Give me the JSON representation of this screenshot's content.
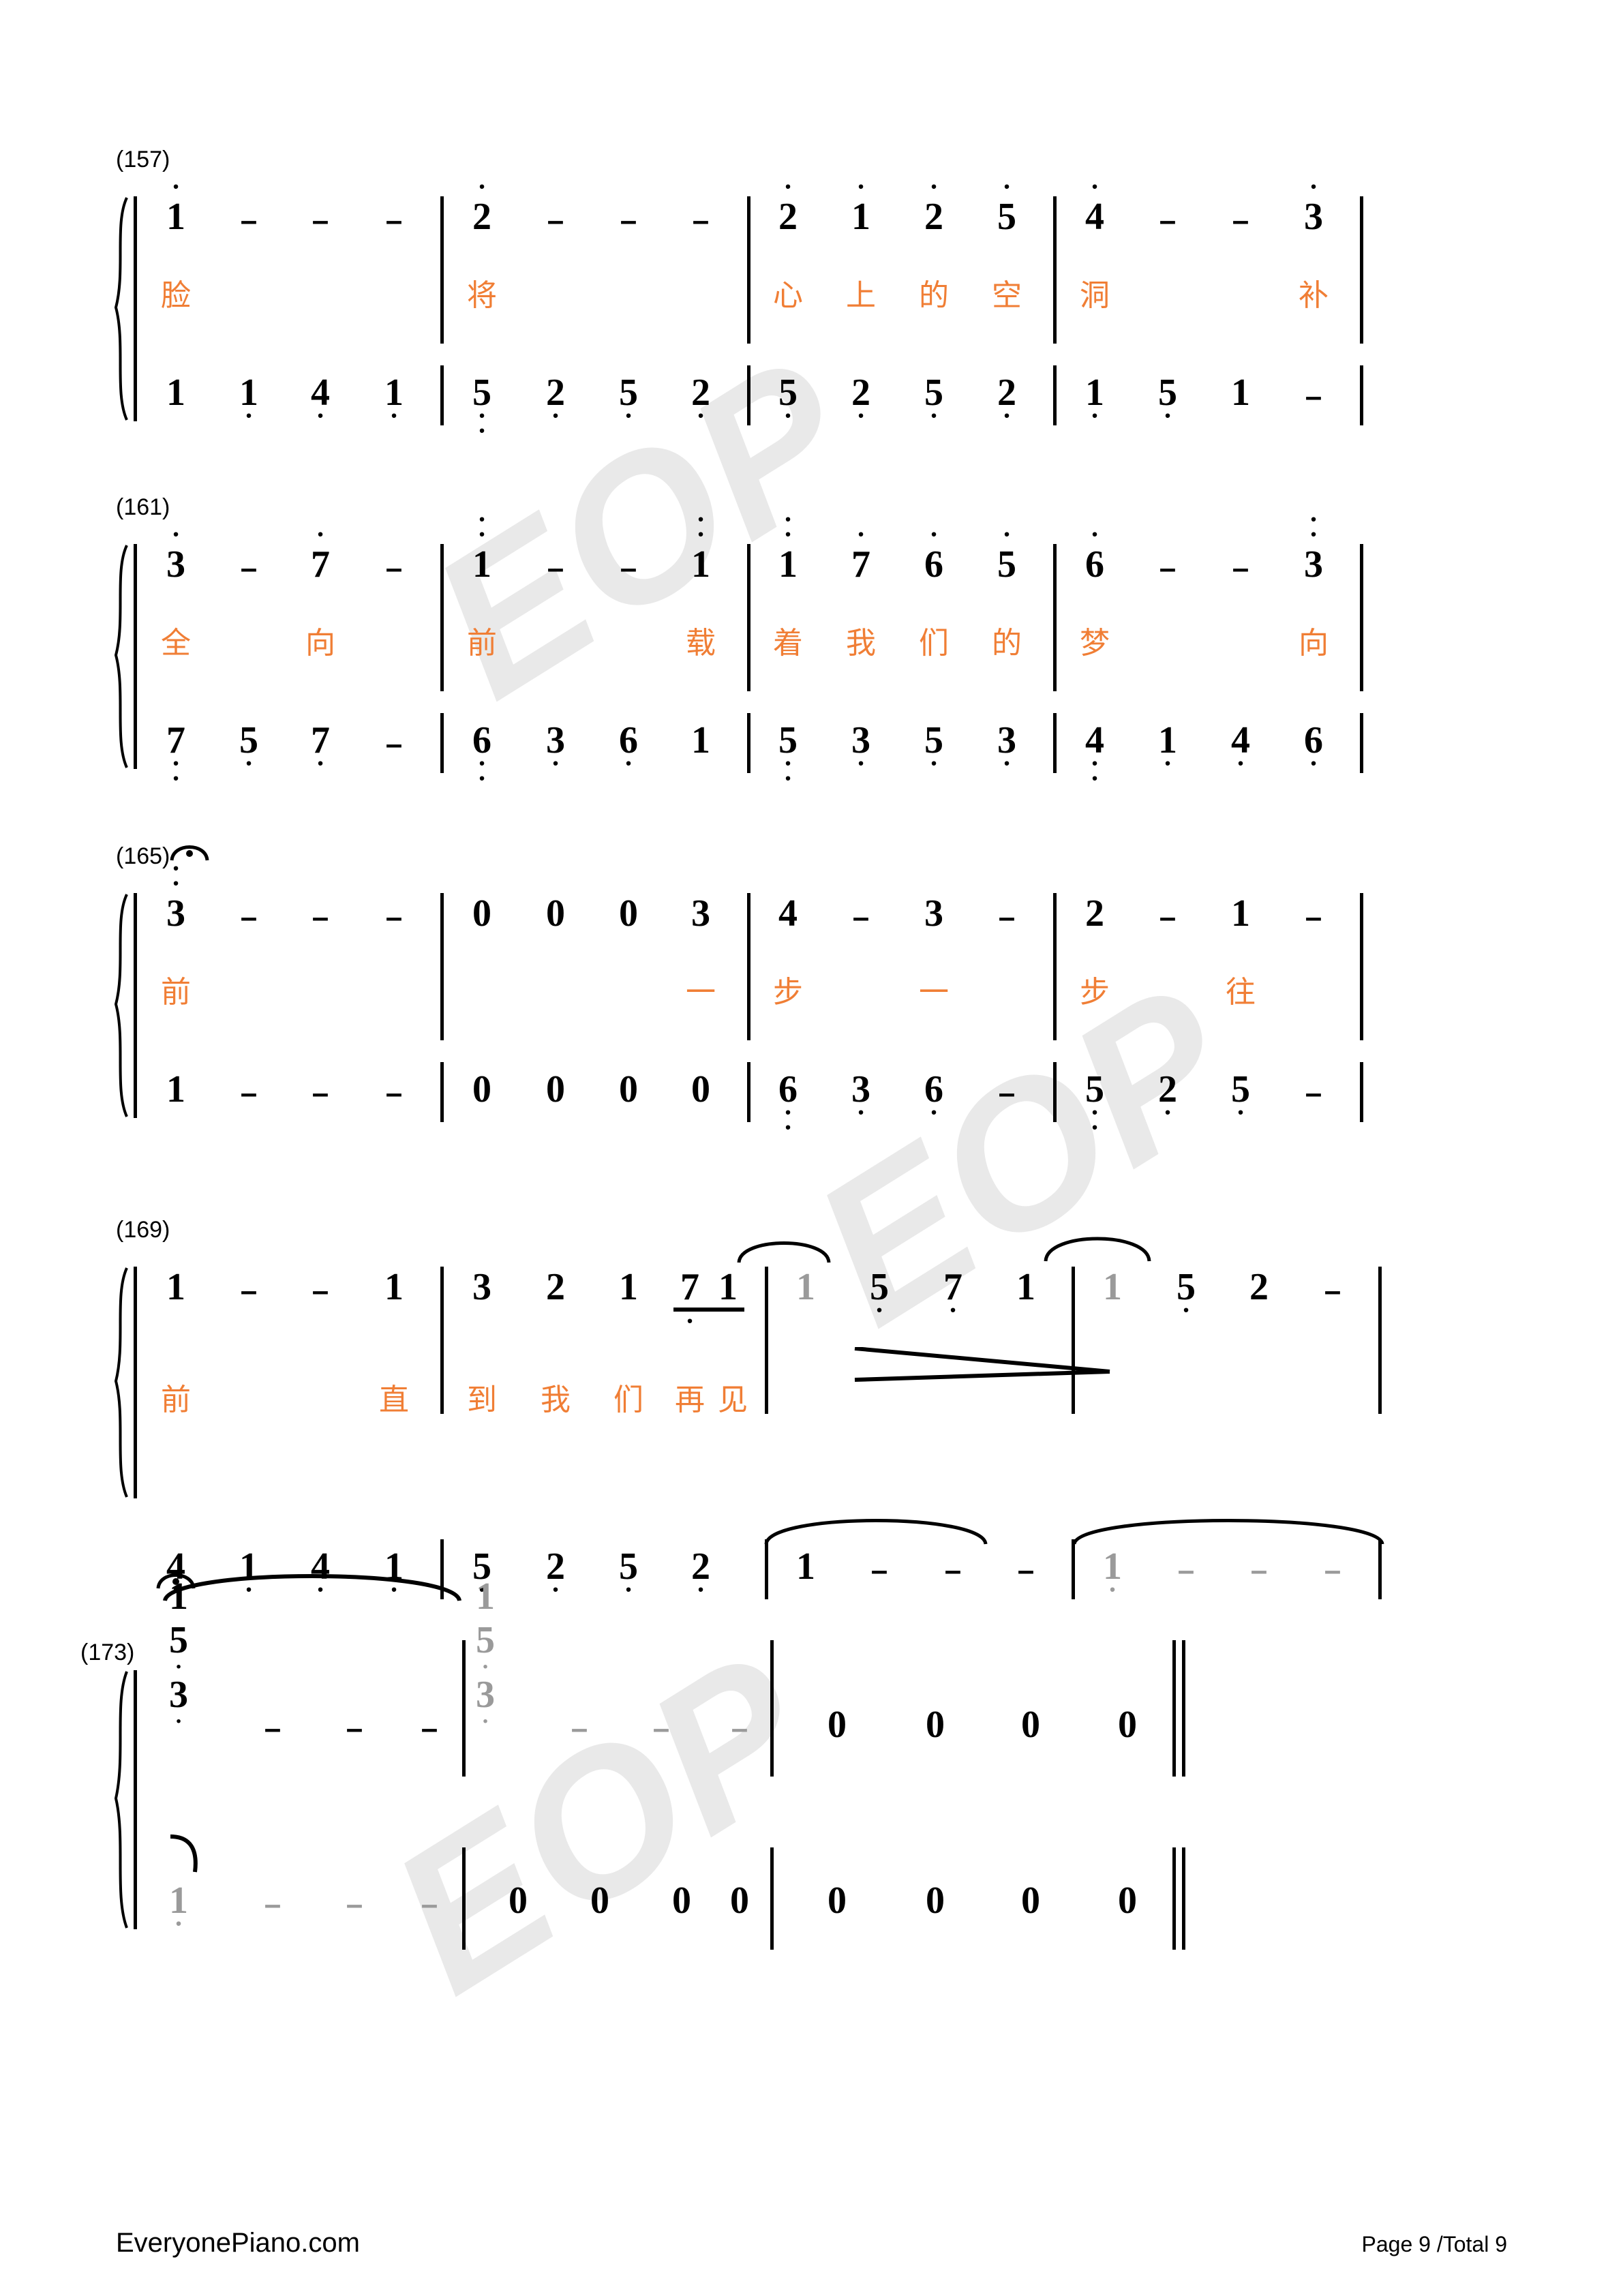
{
  "document": {
    "type": "jianpu-numbered-musical-notation",
    "page_label": "Page 9 /Total 9",
    "site": "EveryonePiano.com",
    "watermark_text": "EOP",
    "lyric_color": "#f07e35",
    "ink_color": "#000000",
    "tie_note_color": "#9a9a9a",
    "watermark_color": "#e9e9e9"
  },
  "systems": [
    {
      "id": "system-157",
      "measure_label": "(157)",
      "treble": [
        {
          "t": "1",
          "oct_up": 1
        },
        {
          "t": "–"
        },
        {
          "t": "–"
        },
        {
          "t": "–"
        },
        {
          "bar": true
        },
        {
          "t": "2",
          "oct_up": 1
        },
        {
          "t": "–"
        },
        {
          "t": "–"
        },
        {
          "t": "–"
        },
        {
          "bar": true
        },
        {
          "t": "2",
          "oct_up": 1
        },
        {
          "t": "1",
          "oct_up": 1
        },
        {
          "t": "2",
          "oct_up": 1
        },
        {
          "t": "5",
          "oct_up": 1
        },
        {
          "bar": true
        },
        {
          "t": "4",
          "oct_up": 1
        },
        {
          "t": "–"
        },
        {
          "t": "–"
        },
        {
          "t": "3",
          "oct_up": 1
        },
        {
          "bar": true
        }
      ],
      "lyrics": [
        "脸",
        "",
        "",
        "",
        "将",
        "",
        "",
        "",
        "心",
        "上",
        "的",
        "空",
        "洞",
        "",
        "",
        "补"
      ],
      "bass": [
        {
          "t": "1"
        },
        {
          "t": "1",
          "oct_dn": 1
        },
        {
          "t": "4",
          "oct_dn": 1
        },
        {
          "t": "1",
          "oct_dn": 1
        },
        {
          "bar": true
        },
        {
          "t": "5",
          "oct_dn": 2
        },
        {
          "t": "2",
          "oct_dn": 1
        },
        {
          "t": "5",
          "oct_dn": 1
        },
        {
          "t": "2",
          "oct_dn": 1
        },
        {
          "bar": true
        },
        {
          "t": "5",
          "oct_dn": 1
        },
        {
          "t": "2",
          "oct_dn": 1
        },
        {
          "t": "5",
          "oct_dn": 1
        },
        {
          "t": "2",
          "oct_dn": 1
        },
        {
          "bar": true
        },
        {
          "t": "1",
          "oct_dn": 1
        },
        {
          "t": "5",
          "oct_dn": 1
        },
        {
          "t": "1"
        },
        {
          "t": "–"
        },
        {
          "bar": true
        }
      ]
    },
    {
      "id": "system-161",
      "measure_label": "(161)",
      "treble": [
        {
          "t": "3",
          "oct_up": 1
        },
        {
          "t": "–"
        },
        {
          "t": "7",
          "oct_up": 1
        },
        {
          "t": "–"
        },
        {
          "bar": true
        },
        {
          "t": "1",
          "oct_up": 2
        },
        {
          "t": "–"
        },
        {
          "t": "–"
        },
        {
          "t": "1",
          "oct_up": 2
        },
        {
          "bar": true
        },
        {
          "t": "1",
          "oct_up": 2
        },
        {
          "t": "7",
          "oct_up": 1
        },
        {
          "t": "6",
          "oct_up": 1
        },
        {
          "t": "5",
          "oct_up": 1
        },
        {
          "bar": true
        },
        {
          "t": "6",
          "oct_up": 1
        },
        {
          "t": "–"
        },
        {
          "t": "–"
        },
        {
          "t": "3",
          "oct_up": 2
        },
        {
          "bar": true
        }
      ],
      "lyrics": [
        "全",
        "",
        "向",
        "",
        "前",
        "",
        "",
        "",
        "载",
        "着",
        "我",
        "们",
        "的",
        "梦",
        "",
        "向"
      ],
      "bass": [
        {
          "t": "7",
          "oct_dn": 2
        },
        {
          "t": "5",
          "oct_dn": 1
        },
        {
          "t": "7",
          "oct_dn": 1
        },
        {
          "t": "–"
        },
        {
          "bar": true
        },
        {
          "t": "6",
          "oct_dn": 2
        },
        {
          "t": "3",
          "oct_dn": 1
        },
        {
          "t": "6",
          "oct_dn": 1
        },
        {
          "t": "1"
        },
        {
          "bar": true
        },
        {
          "t": "5",
          "oct_dn": 2
        },
        {
          "t": "3",
          "oct_dn": 1
        },
        {
          "t": "5",
          "oct_dn": 1
        },
        {
          "t": "3",
          "oct_dn": 1
        },
        {
          "bar": true
        },
        {
          "t": "4",
          "oct_dn": 2
        },
        {
          "t": "1",
          "oct_dn": 1
        },
        {
          "t": "4",
          "oct_dn": 1
        },
        {
          "t": "6",
          "oct_dn": 1
        },
        {
          "bar": true
        }
      ]
    },
    {
      "id": "system-165",
      "measure_label": "(165)",
      "fermata": true,
      "treble": [
        {
          "t": "3",
          "oct_up": 2
        },
        {
          "t": "–"
        },
        {
          "t": "–"
        },
        {
          "t": "–"
        },
        {
          "bar": true
        },
        {
          "t": "0"
        },
        {
          "t": "0"
        },
        {
          "t": "0"
        },
        {
          "t": "3"
        },
        {
          "bar": true
        },
        {
          "t": "4"
        },
        {
          "t": "–"
        },
        {
          "t": "3"
        },
        {
          "t": "–"
        },
        {
          "bar": true
        },
        {
          "t": "2"
        },
        {
          "t": "–"
        },
        {
          "t": "1"
        },
        {
          "t": "–"
        },
        {
          "bar": true
        }
      ],
      "lyrics": [
        "前",
        "",
        "",
        "",
        "",
        "",
        "",
        "一",
        "步",
        "",
        "一",
        "",
        "步",
        "",
        "往",
        ""
      ],
      "bass": [
        {
          "t": "1"
        },
        {
          "t": "–"
        },
        {
          "t": "–"
        },
        {
          "t": "–"
        },
        {
          "bar": true
        },
        {
          "t": "0"
        },
        {
          "t": "0"
        },
        {
          "t": "0"
        },
        {
          "t": "0"
        },
        {
          "bar": true
        },
        {
          "t": "6",
          "oct_dn": 2
        },
        {
          "t": "3",
          "oct_dn": 1
        },
        {
          "t": "6",
          "oct_dn": 1
        },
        {
          "t": "–"
        },
        {
          "bar": true
        },
        {
          "t": "5",
          "oct_dn": 2
        },
        {
          "t": "2",
          "oct_dn": 1
        },
        {
          "t": "5",
          "oct_dn": 1
        },
        {
          "t": "–"
        },
        {
          "bar": true
        }
      ]
    },
    {
      "id": "system-169",
      "measure_label": "(169)",
      "treble": [
        {
          "t": "1"
        },
        {
          "t": "–"
        },
        {
          "t": "–"
        },
        {
          "t": "1"
        },
        {
          "bar": true
        },
        {
          "t": "3"
        },
        {
          "t": "2"
        },
        {
          "t": "1"
        },
        {
          "t": "7",
          "oct_dn": 1,
          "beam": true
        },
        {
          "t": "1",
          "beam": true
        },
        {
          "bar": true
        },
        {
          "t": "1",
          "grey": true
        },
        {
          "t": "5",
          "oct_dn": 1
        },
        {
          "t": "7",
          "oct_dn": 1
        },
        {
          "t": "1"
        },
        {
          "bar": true
        },
        {
          "t": "1",
          "grey": true
        },
        {
          "t": "5",
          "oct_dn": 1
        },
        {
          "t": "2"
        },
        {
          "t": "–"
        },
        {
          "bar": true
        }
      ],
      "lyrics": [
        "前",
        "",
        "",
        "直",
        "到",
        "我",
        "们",
        "再",
        "见"
      ],
      "bass": [
        {
          "t": "4",
          "oct_dn": 1
        },
        {
          "t": "1",
          "oct_dn": 1
        },
        {
          "t": "4",
          "oct_dn": 1
        },
        {
          "t": "1",
          "oct_dn": 1
        },
        {
          "bar": true
        },
        {
          "t": "5",
          "oct_dn": 1
        },
        {
          "t": "2",
          "oct_dn": 1
        },
        {
          "t": "5",
          "oct_dn": 1
        },
        {
          "t": "2",
          "oct_dn": 1
        },
        {
          "bar": true
        },
        {
          "t": "1"
        },
        {
          "t": "–"
        },
        {
          "t": "–"
        },
        {
          "t": "–"
        },
        {
          "bar": true
        },
        {
          "t": "1",
          "oct_dn": 1,
          "grey": true
        },
        {
          "t": "–",
          "grey": true
        },
        {
          "t": "–",
          "grey": true
        },
        {
          "t": "–",
          "grey": true
        },
        {
          "bar": true
        }
      ],
      "hairpin": "diminuendo"
    },
    {
      "id": "system-173",
      "measure_label": "(173)",
      "fermata": true,
      "treble_chords": [
        {
          "stack": [
            "1",
            "5",
            "3"
          ],
          "dot_after": [
            false,
            true,
            true
          ],
          "grey": false
        },
        {
          "t": "–"
        },
        {
          "t": "–"
        },
        {
          "t": "–"
        },
        {
          "bar": true
        },
        {
          "stack": [
            "1",
            "5",
            "3"
          ],
          "dot_after": [
            false,
            true,
            true
          ],
          "grey": true
        },
        {
          "t": "–",
          "grey": true
        },
        {
          "t": "–",
          "grey": true
        },
        {
          "t": "–",
          "grey": true
        },
        {
          "bar": true
        },
        {
          "t": "0"
        },
        {
          "t": "0"
        },
        {
          "t": "0"
        },
        {
          "t": "0"
        },
        {
          "final": true
        }
      ],
      "bass": [
        {
          "t": "1",
          "oct_dn": 1,
          "grey": true
        },
        {
          "t": "–",
          "grey": true
        },
        {
          "t": "–",
          "grey": true
        },
        {
          "t": "–",
          "grey": true
        },
        {
          "bar": true
        },
        {
          "t": "0"
        },
        {
          "t": "0"
        },
        {
          "t": "0"
        },
        {
          "t": "0"
        },
        {
          "bar": true
        },
        {
          "t": "0"
        },
        {
          "t": "0"
        },
        {
          "t": "0"
        },
        {
          "t": "0"
        },
        {
          "final": true
        }
      ]
    }
  ],
  "footer": {
    "site": "EveryonePiano.com",
    "page": "Page 9 /Total 9"
  }
}
